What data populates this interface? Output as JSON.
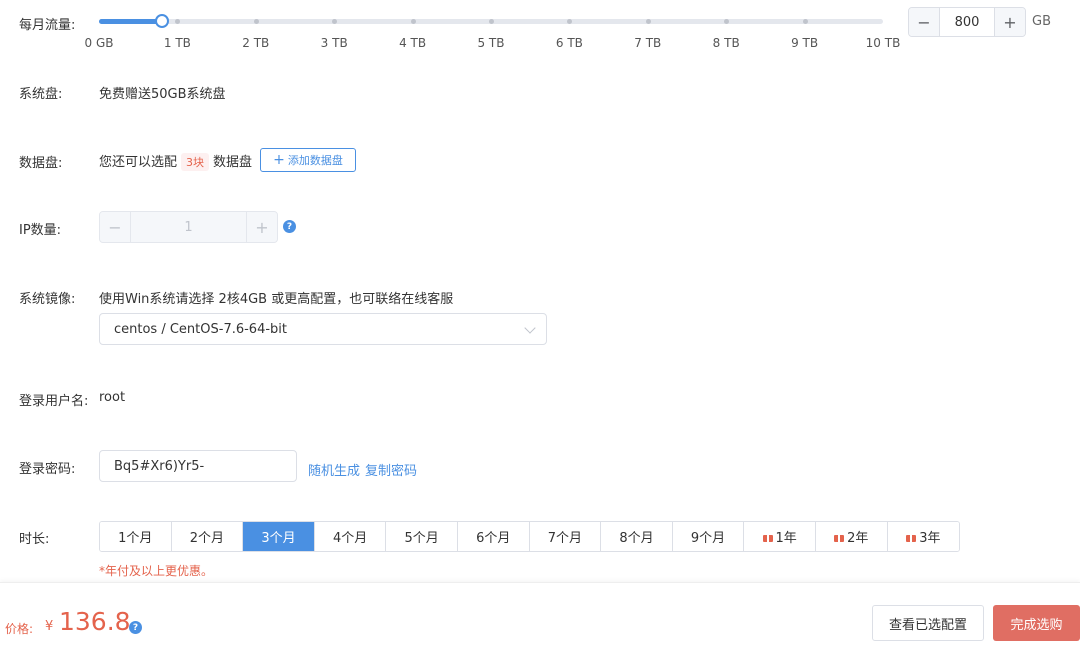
{
  "traffic": {
    "label": "每月流量:",
    "value": 0.08,
    "ticks": [
      "0 GB",
      "1 TB",
      "2 TB",
      "3 TB",
      "4 TB",
      "5 TB",
      "6 TB",
      "7 TB",
      "8 TB",
      "9 TB",
      "10 TB"
    ],
    "stepper_value": "800",
    "unit": "GB",
    "minus": "−",
    "plus": "+"
  },
  "system_disk": {
    "label": "系统盘:",
    "text": "免费赠送50GB系统盘"
  },
  "data_disk": {
    "label": "数据盘:",
    "prefix": "您还可以选配",
    "badge": "3块",
    "suffix": "数据盘",
    "add_button": "添加数据盘",
    "add_icon": "+"
  },
  "ip": {
    "label": "IP数量:",
    "value": "1",
    "minus": "−",
    "plus": "+",
    "help": "?"
  },
  "image": {
    "label": "系统镜像:",
    "hint": "使用Win系统请选择 2核4GB 或更高配置，也可联络在线客服",
    "selected": "centos / CentOS-7.6-64-bit"
  },
  "username": {
    "label": "登录用户名:",
    "value": "root"
  },
  "password": {
    "label": "登录密码:",
    "value": "Bq5#Xr6)Yr5-",
    "random": "随机生成",
    "copy": "复制密码"
  },
  "duration": {
    "label": "时长:",
    "options": [
      {
        "label": "1个月",
        "gift": false
      },
      {
        "label": "2个月",
        "gift": false
      },
      {
        "label": "3个月",
        "gift": false
      },
      {
        "label": "4个月",
        "gift": false
      },
      {
        "label": "5个月",
        "gift": false
      },
      {
        "label": "6个月",
        "gift": false
      },
      {
        "label": "7个月",
        "gift": false
      },
      {
        "label": "8个月",
        "gift": false
      },
      {
        "label": "9个月",
        "gift": false
      },
      {
        "label": "1年",
        "gift": true
      },
      {
        "label": "2年",
        "gift": true
      },
      {
        "label": "3年",
        "gift": true
      }
    ],
    "active_index": 2,
    "note": "*年付及以上更优惠。"
  },
  "footer": {
    "price_label": "价格:",
    "currency": "¥",
    "price": "136.8",
    "help": "?",
    "view_button": "查看已选配置",
    "buy_button": "完成选购"
  },
  "colors": {
    "accent": "#4a90e2",
    "price": "#e4634c",
    "buy": "#e06e63"
  }
}
